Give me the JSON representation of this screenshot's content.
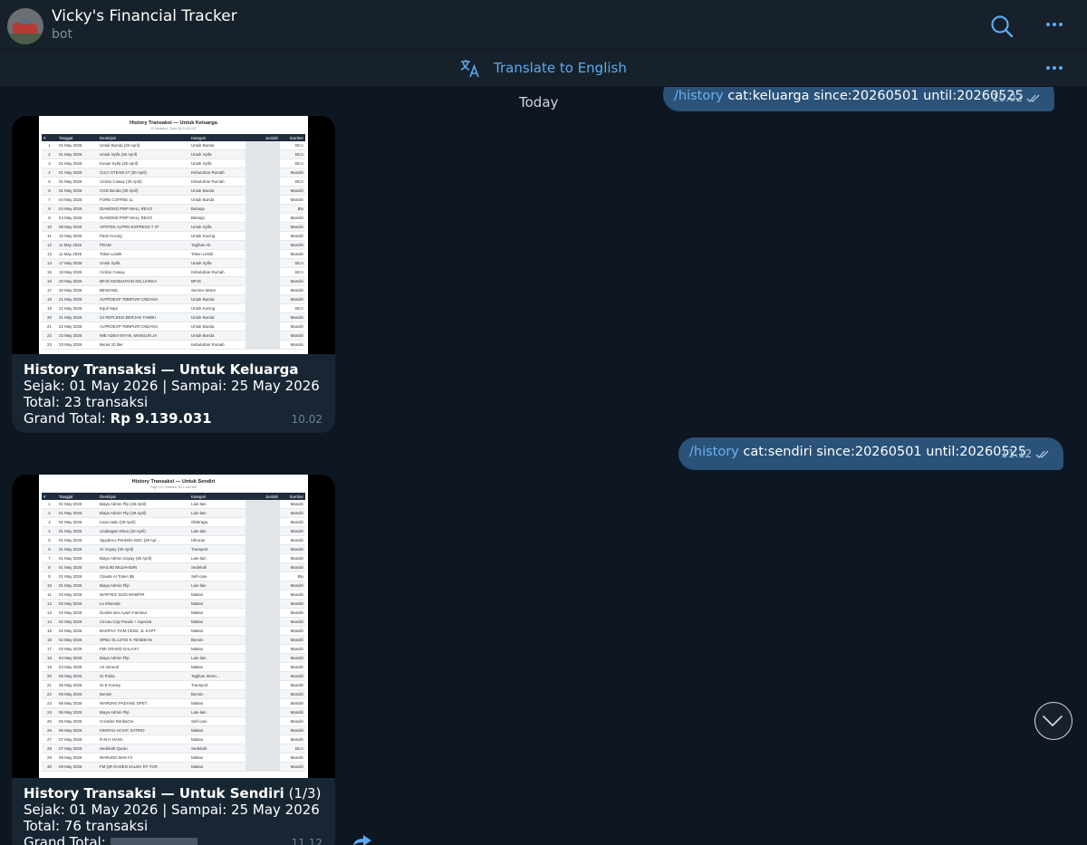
{
  "header": {
    "title": "Vicky's Financial Tracker",
    "subtitle": "bot"
  },
  "translate": {
    "label": "Translate to English"
  },
  "chat": {
    "date_separator": "Today"
  },
  "messages": {
    "out1": {
      "command": "/history",
      "text": " cat:keluarga since:20260501 until:20260525",
      "time": "10.02"
    },
    "out2": {
      "command": "/history",
      "text": " cat:sendiri since:20260501 until:20260525",
      "time": "11.12"
    },
    "in1": {
      "sheet_title": "History Transaksi — Untuk Keluarga",
      "sheet_subtitle": "23 transaksi | Total: Rp 9.139.031",
      "caption_title": "History Transaksi — Untuk Keluarga",
      "caption_range": "Sejak: 01 May 2026 | Sampai: 25 May 2026",
      "caption_total": "Total: 23 transaksi",
      "caption_grand_label": "Grand Total: ",
      "caption_grand_value": "Rp 9.139.031",
      "time": "10.02"
    },
    "in2": {
      "sheet_title": "History Transaksi — Untuk Sendiri",
      "sheet_subtitle": "Page 1/3 | Subtotal: Rp 1.405.565",
      "caption_title": "History Transaksi — Untuk Sendiri",
      "caption_page": " (1/3)",
      "caption_range": "Sejak: 01 May 2026 | Sampai: 25 May 2026",
      "caption_total": "Total: 76 transaksi",
      "caption_grand_label": "Grand Total: ",
      "time": "11.12"
    }
  },
  "table_headers": [
    "#",
    "Tanggal",
    "Deskripsi",
    "Kategori",
    "Jumlah",
    "Sumber"
  ],
  "table1_rows": [
    [
      "1",
      "01 May 2026",
      "Untuk Bunda (28 April)",
      "Untuk Bunda",
      "",
      "BCA"
    ],
    [
      "2",
      "01 May 2026",
      "Untuk Syifa (28 April)",
      "Untuk Syifa",
      "",
      "BCA"
    ],
    [
      "3",
      "01 May 2026",
      "Kosan Syifa (28 April)",
      "Untuk Syifa",
      "",
      "BCA"
    ],
    [
      "4",
      "01 May 2026",
      "CUCI STEAM 47 (30 April)",
      "Kebutuhan Rumah",
      "",
      "Mandiri"
    ],
    [
      "5",
      "01 May 2026",
      "Cicilan Coway (30 April)",
      "Kebutuhan Rumah",
      "",
      "BCA"
    ],
    [
      "6",
      "01 May 2026",
      "COD Bunda (30 April)",
      "Untuk Bunda",
      "",
      "Mandiri"
    ],
    [
      "7",
      "04 May 2026",
      "FORE COFFEE 1L",
      "Untuk Bunda",
      "",
      "Mandiri"
    ],
    [
      "8",
      "04 May 2026",
      "DIAMOND PWP MALL REVO",
      "Belanja",
      "",
      "Blu"
    ],
    [
      "9",
      "04 May 2026",
      "DIAMOND PWP MALL REVO",
      "Belanja",
      "",
      "Mandiri"
    ],
    [
      "10",
      "09 May 2026",
      "APOTEK ALPRO EXPRESS T 37",
      "Untuk Syifa",
      "",
      "Mandiri"
    ],
    [
      "11",
      "10 May 2026",
      "Pasir Kucing",
      "Untuk Kucing",
      "",
      "Mandiri"
    ],
    [
      "12",
      "11 May 2026",
      "PDAM",
      "Tagihan Air",
      "",
      "Mandiri"
    ],
    [
      "13",
      "11 May 2026",
      "Token Listrik",
      "Token Listrik",
      "",
      "Mandiri"
    ],
    [
      "14",
      "17 May 2026",
      "Untuk Syifa",
      "Untuk Syifa",
      "",
      "BCA"
    ],
    [
      "15",
      "18 May 2026",
      "Cicilan Coway",
      "Kebutuhan Rumah",
      "",
      "BCA"
    ],
    [
      "16",
      "20 May 2026",
      "BPJS KESEHATAN KELUARGA",
      "BPJS",
      "",
      "Mandiri"
    ],
    [
      "17",
      "20 May 2026",
      "BENGKEL",
      "Service Motor",
      "",
      "Mandiri"
    ],
    [
      "18",
      "21 May 2026",
      "ALPROEXP TMNPURI CNDANA",
      "Untuk Bunda",
      "",
      "Mandiri"
    ],
    [
      "19",
      "21 May 2026",
      "Equil Sapi",
      "Untuk Kucing",
      "",
      "BCA"
    ],
    [
      "20",
      "21 May 2026",
      "SJ REFLEKSI BERJAN TAMBU",
      "Untuk Bunda",
      "",
      "Mandiri"
    ],
    [
      "21",
      "22 May 2026",
      "ALPROEXP TMNPURI CNDANA",
      "Untuk Bunda",
      "",
      "Mandiri"
    ],
    [
      "22",
      "23 May 2026",
      "MIE ADEH INTAN, MANGUN JA",
      "Untuk Bunda",
      "",
      "Mandiri"
    ],
    [
      "23",
      "23 May 2026",
      "Beras 10 liter",
      "Kebutuhan Rumah",
      "",
      "Mandiri"
    ]
  ],
  "table2_rows": [
    [
      "1",
      "01 May 2026",
      "Biaya Admin Flip (28 April)",
      "Lain-lain",
      "",
      "Mandiri"
    ],
    [
      "2",
      "01 May 2026",
      "Biaya Admin Flip (28 April)",
      "Lain-lain",
      "",
      "Mandiri"
    ],
    [
      "3",
      "01 May 2026",
      "Iuran Iaido (29 April)",
      "Olahraga",
      "",
      "Mandiri"
    ],
    [
      "4",
      "01 May 2026",
      "Undangan Dhea (29 April)",
      "Lain-lain",
      "",
      "Mandiri"
    ],
    [
      "5",
      "01 May 2026",
      "Spyderco Penknife EDC (29 Apr…",
      "Hiburan",
      "",
      "Mandiri"
    ],
    [
      "6",
      "01 May 2026",
      "Isi Gopay (30 April)",
      "Transport",
      "",
      "Mandiri"
    ],
    [
      "7",
      "01 May 2026",
      "Biaya Admin Gopay (30 April)",
      "Lain-lain",
      "",
      "Mandiri"
    ],
    [
      "8",
      "01 May 2026",
      "MASJID MUJAHIDIN",
      "Sedekah",
      "",
      "Mandiri"
    ],
    [
      "9",
      "01 May 2026",
      "Claude AI Token $5",
      "Self-care",
      "",
      "Blu"
    ],
    [
      "10",
      "01 May 2026",
      "Biaya Admin Flip",
      "Lain-lain",
      "",
      "Mandiri"
    ],
    [
      "11",
      "02 May 2026",
      "WARTEG SUDI MAMPIR",
      "Makan",
      "",
      "Mandiri"
    ],
    [
      "12",
      "02 May 2026",
      "Le Minerale",
      "Makan",
      "",
      "Mandiri"
    ],
    [
      "13",
      "02 May 2026",
      "Double Box Ayam Famima",
      "Makan",
      "",
      "Mandiri"
    ],
    [
      "14",
      "02 May 2026",
      "Cincau Cap Panda + Aquviva",
      "Makan",
      "",
      "Mandiri"
    ],
    [
      "15",
      "02 May 2026",
      "BAKPAO TIAM CENZ, JL KAPT",
      "Makan",
      "",
      "Mandiri"
    ],
    [
      "16",
      "02 May 2026",
      "SPBU 31.12702 K.TENDEAN",
      "Bensin",
      "",
      "Mandiri"
    ],
    [
      "17",
      "03 May 2026",
      "FMI GRAND GALAXY",
      "Makan",
      "",
      "Mandiri"
    ],
    [
      "18",
      "04 May 2026",
      "Biaya Admin Flip",
      "Lain-lain",
      "",
      "Mandiri"
    ],
    [
      "19",
      "04 May 2026",
      "Air mineral",
      "Makan",
      "",
      "Mandiri"
    ],
    [
      "20",
      "05 May 2026",
      "Isi Pulsa",
      "Tagihan Intern…",
      "",
      "Mandiri"
    ],
    [
      "21",
      "05 May 2026",
      "Isi E-money",
      "Transport",
      "",
      "Mandiri"
    ],
    [
      "22",
      "06 May 2026",
      "Bensin",
      "Bensin",
      "",
      "Mandiri"
    ],
    [
      "23",
      "06 May 2026",
      "WARUNG PADANG OPET",
      "Makan",
      "",
      "Mandiri"
    ],
    [
      "24",
      "06 May 2026",
      "Biaya Admin Flip",
      "Lain-lain",
      "",
      "Mandiri"
    ],
    [
      "25",
      "06 May 2026",
      "Creatine RimbaCre",
      "Self-care",
      "",
      "Mandiri"
    ],
    [
      "26",
      "06 May 2026",
      "KIMITAU ACIAP, SATRIO",
      "Makan",
      "",
      "Mandiri"
    ],
    [
      "27",
      "07 May 2026",
      "R M H NANA",
      "Makan",
      "",
      "Mandiri"
    ],
    [
      "28",
      "07 May 2026",
      "Sedekah Quran",
      "Sedekah",
      "",
      "BCA"
    ],
    [
      "29",
      "09 May 2026",
      "WARUNG BHS F2",
      "Makan",
      "",
      "Mandiri"
    ],
    [
      "30",
      "09 May 2026",
      "FM QR RADEN SALEH RY TGR",
      "Makan",
      "",
      "Mandiri"
    ]
  ],
  "icons": {
    "search": "search-icon",
    "more": "more-dots-icon",
    "translate": "translate-icon",
    "scroll_down": "chevron-down-icon",
    "forward": "forward-icon",
    "read_receipt": "double-check-icon"
  },
  "colors": {
    "header_bg": "#17212b",
    "chat_bg": "#0e1621",
    "outgoing_bubble": "#2b5278",
    "incoming_bubble": "#182533",
    "accent": "#5eaaf0",
    "command_link": "#6ab3f3"
  }
}
